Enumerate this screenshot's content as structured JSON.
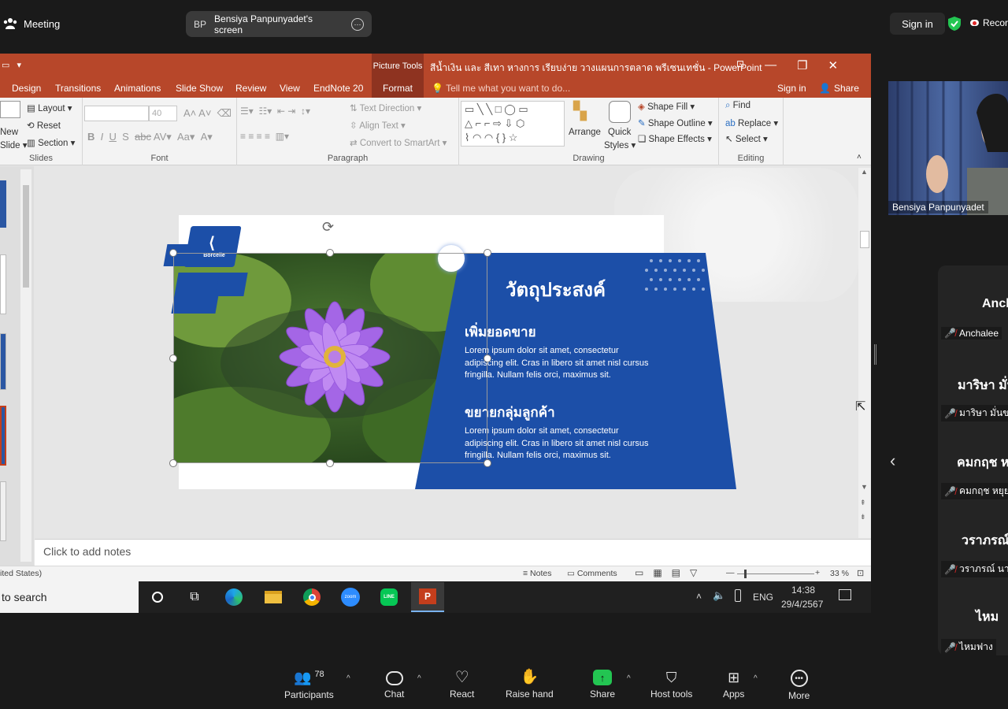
{
  "zoom": {
    "meeting_label": "Meeting",
    "screen_initials": "BP",
    "screen_label": "Bensiya Panpunyadet's screen",
    "sign_in": "Sign in",
    "record_label": "Recor",
    "video_name": "Bensiya Panpunyadet",
    "participants": [
      {
        "big": "Anch",
        "small": "Anchalee"
      },
      {
        "big": "มาริษา มั่น",
        "small": "มาริษา มั่นขา"
      },
      {
        "big": "คมกฤช ห",
        "small": "คมกฤช หยุย"
      },
      {
        "big": "วราภรณ์",
        "small": "วราภรณ์ นาค"
      },
      {
        "big": "ไหม",
        "small": "ไหมฟาง"
      }
    ],
    "toolbar": {
      "participants_label": "Participants",
      "participants_count": "78",
      "chat": "Chat",
      "react": "React",
      "raise_hand": "Raise hand",
      "share": "Share",
      "host_tools": "Host tools",
      "apps": "Apps",
      "more": "More"
    },
    "colors": {
      "share_green": "#23c552",
      "mute_red": "#e02828"
    }
  },
  "ppt": {
    "picture_tools": "Picture Tools",
    "title": "สีน้ำเงิน และ สีเทา หางการ เรียบง่าย วางแผนการตลาด พรีเซนเทชั่น - PowerPoint",
    "tabs": [
      "Design",
      "Transitions",
      "Animations",
      "Slide Show",
      "Review",
      "View",
      "EndNote 20"
    ],
    "format_tab": "Format",
    "tell_me": "Tell me what you want to do...",
    "sign_in": "Sign in",
    "share": "Share",
    "ribbon": {
      "slides": {
        "new": "New",
        "slide": "Slide",
        "layout": "Layout",
        "reset": "Reset",
        "section": "Section",
        "label": "Slides"
      },
      "font": {
        "size": "40",
        "label": "Font"
      },
      "paragraph": {
        "text_direction": "Text Direction",
        "align_text": "Align Text",
        "convert": "Convert to SmartArt",
        "label": "Paragraph"
      },
      "drawing": {
        "arrange": "Arrange",
        "quick": "Quick",
        "styles": "Styles",
        "shape_fill": "Shape Fill",
        "shape_outline": "Shape Outline",
        "shape_effects": "Shape Effects",
        "label": "Drawing"
      },
      "editing": {
        "find": "Find",
        "replace": "Replace",
        "select": "Select",
        "label": "Editing"
      }
    },
    "slide": {
      "logo": "Borcelle",
      "title": "วัตถุประสงค์",
      "h1": "เพิ่มยอดขาย",
      "p1": "Lorem ipsum dolor sit amet, consectetur adipiscing elit. Cras in libero sit amet nisl cursus fringilla. Nullam felis orci, maximus sit.",
      "h2": "ขยายกลุ่มลูกค้า",
      "p2": "Lorem ipsum dolor sit amet, consectetur adipiscing elit. Cras in libero sit amet nisl cursus fringilla. Nullam felis orci, maximus sit."
    },
    "notes_placeholder": "Click to add notes",
    "status": {
      "lang": "ited States)",
      "notes": "Notes",
      "comments": "Comments",
      "zoom": "33 %"
    },
    "colors": {
      "brand": "#b7472a",
      "slide_blue": "#1c4fa8"
    }
  },
  "taskbar": {
    "search": "to search",
    "lang": "ENG",
    "time": "14:38",
    "date": "29/4/2567",
    "apps": [
      "task-view",
      "edge",
      "explorer",
      "chrome",
      "zoom",
      "line",
      "powerpoint"
    ]
  }
}
